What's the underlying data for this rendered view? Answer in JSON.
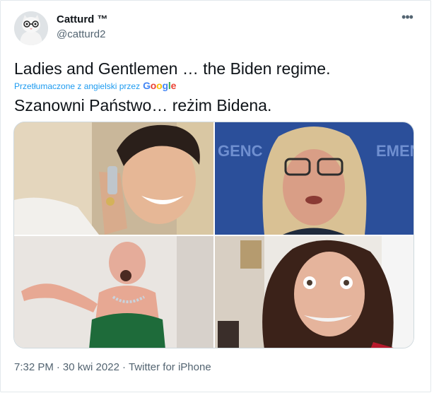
{
  "author": {
    "display_name": "Catturd ™",
    "handle": "@catturd2",
    "avatar_icon": "cat-avatar-icon"
  },
  "more_menu": {
    "label": "•••",
    "icon": "more-options-icon"
  },
  "tweet": {
    "text": "Ladies and Gentlemen … the Biden regime.",
    "translated_by": "Przetłumaczone z angielski przez",
    "translator_brand": [
      "G",
      "o",
      "o",
      "g",
      "l",
      "e"
    ],
    "translated_text": "Szanowni Państwo… reżim Bidena."
  },
  "media": {
    "photos": [
      {
        "icon": "photo-1-image"
      },
      {
        "icon": "photo-2-image"
      },
      {
        "icon": "photo-3-image"
      },
      {
        "icon": "photo-4-image"
      }
    ]
  },
  "meta": {
    "time": "7:32 PM",
    "sep1": "·",
    "date": "30 kwi 2022",
    "sep2": "·",
    "source": "Twitter for iPhone"
  },
  "colors": {
    "link": "#1d9bf0",
    "secondary": "#536471",
    "border": "#cfd9de",
    "google_blue": "#4285f4",
    "google_red": "#ea4335",
    "google_yellow": "#fbbc05",
    "google_green": "#34a853"
  }
}
